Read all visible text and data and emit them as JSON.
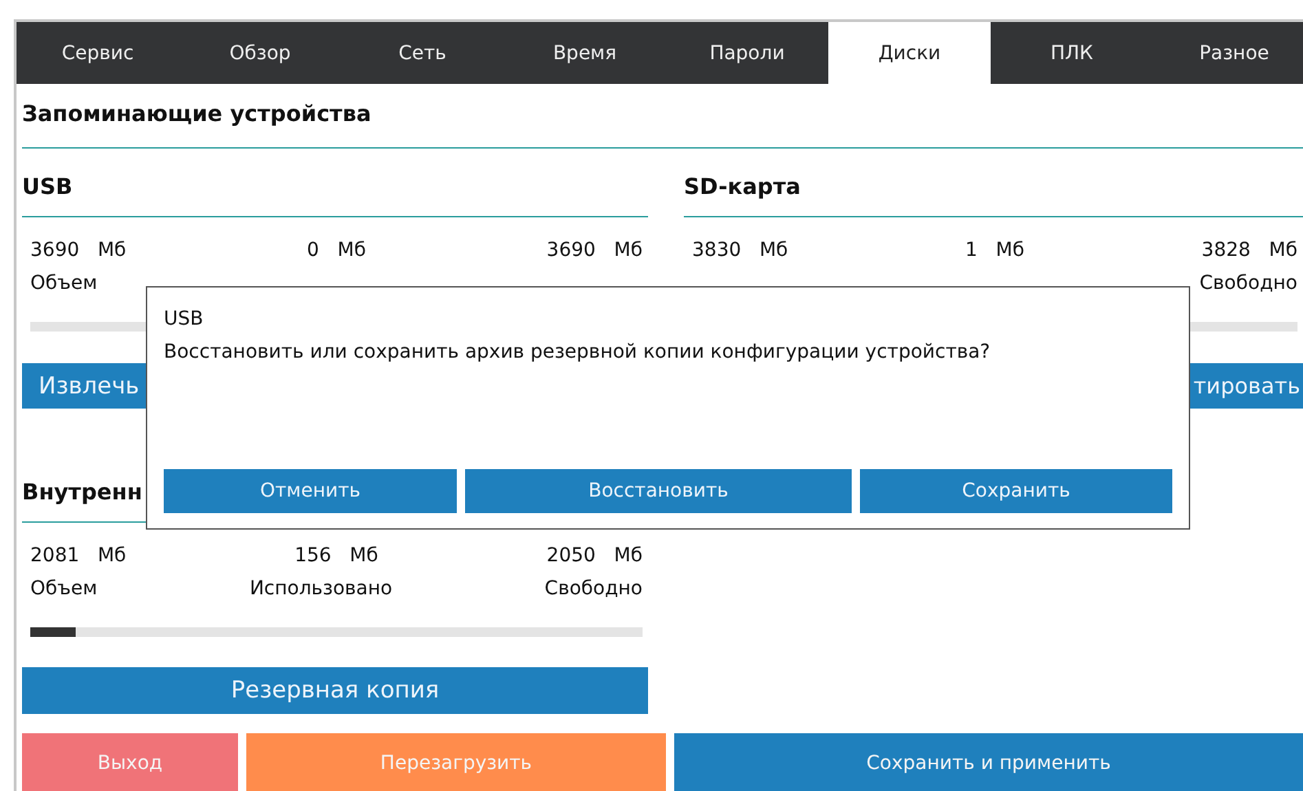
{
  "tabs": [
    {
      "label": "Сервис",
      "selected": false
    },
    {
      "label": "Обзор",
      "selected": false
    },
    {
      "label": "Сеть",
      "selected": false
    },
    {
      "label": "Время",
      "selected": false
    },
    {
      "label": "Пароли",
      "selected": false
    },
    {
      "label": "Диски",
      "selected": true
    },
    {
      "label": "ПЛК",
      "selected": false
    },
    {
      "label": "Разное",
      "selected": false
    }
  ],
  "section_title": "Запоминающие устройства",
  "devices": [
    {
      "title": "USB",
      "columns": [
        {
          "value": "3690",
          "unit": "Мб",
          "label": "Объем"
        },
        {
          "value": "0",
          "unit": "Мб"
        },
        {
          "value": "3690",
          "unit": "Мб"
        }
      ],
      "level": 0,
      "button": "Извлечь"
    },
    {
      "title": "SD-карта",
      "columns": [
        {
          "value": "3830",
          "unit": "Мб"
        },
        {
          "value": "1",
          "unit": "Мб"
        },
        {
          "value": "3828",
          "unit": "Мб",
          "label": "Свободно"
        }
      ],
      "level": 0,
      "button": "тировать"
    },
    {
      "title": "Внутренн",
      "columns": [
        {
          "value": "2081",
          "unit": "Мб",
          "label": "Объем"
        },
        {
          "value": "156",
          "unit": "Мб",
          "label": "Использовано"
        },
        {
          "value": "2050",
          "unit": "Мб",
          "label": "Свободно"
        }
      ],
      "level": 0.075,
      "button": "Резервная копия"
    }
  ],
  "actions": [
    {
      "label": "Выход",
      "kind": "exit"
    },
    {
      "label": "Перезагрузить",
      "kind": "reboot"
    },
    {
      "label": "Сохранить и применить",
      "kind": "apply"
    }
  ],
  "dialog": {
    "title": "USB",
    "message": "Восстановить или сохранить архив резервной копии конфигурации устройства?",
    "buttons": [
      "Отменить",
      "Восстановить",
      "Сохранить"
    ]
  }
}
